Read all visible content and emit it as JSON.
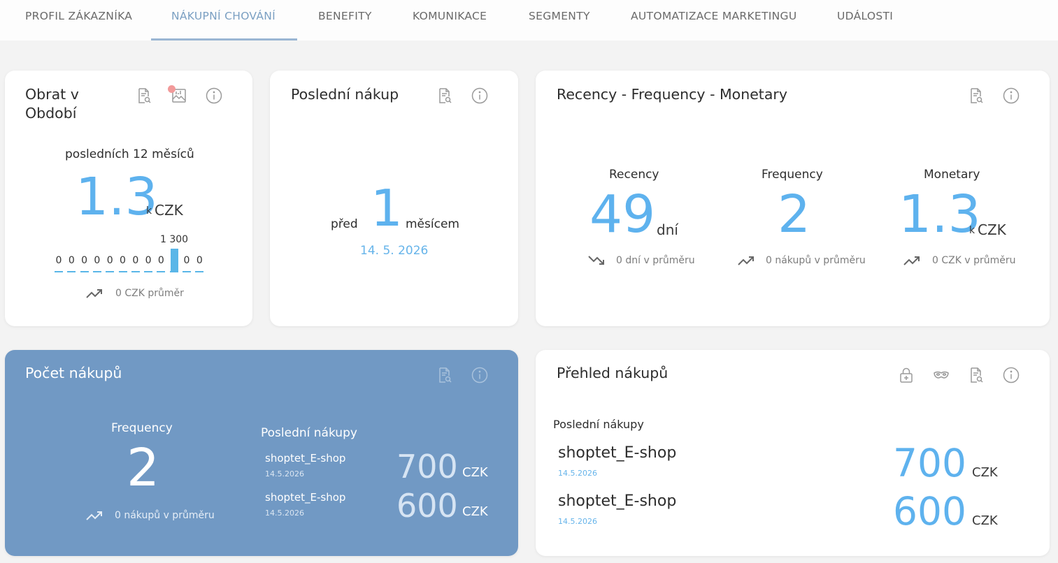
{
  "tabs": [
    {
      "label": "PROFIL ZÁKAZNÍKA",
      "active": false
    },
    {
      "label": "NÁKUPNÍ CHOVÁNÍ",
      "active": true
    },
    {
      "label": "BENEFITY",
      "active": false
    },
    {
      "label": "KOMUNIKACE",
      "active": false
    },
    {
      "label": "SEGMENTY",
      "active": false
    },
    {
      "label": "AUTOMATIZACE MARKETINGU",
      "active": false
    },
    {
      "label": "UDÁLOSTI",
      "active": false
    }
  ],
  "turnover": {
    "title_line1": "Obrat v",
    "title_line2": "Období",
    "period": "posledních 12 měsíců",
    "value": "1.3",
    "suffix": "k",
    "currency": "CZK",
    "bar_label": "1 300",
    "bars": [
      "0",
      "0",
      "0",
      "0",
      "0",
      "0",
      "0",
      "0",
      "0",
      "",
      "0",
      "0"
    ],
    "bar_values": [
      0,
      0,
      0,
      0,
      0,
      0,
      0,
      0,
      0,
      1300,
      0,
      0
    ],
    "avg": "0 CZK průměr"
  },
  "last_purchase": {
    "title": "Poslední nákup",
    "prefix": "před",
    "value": "1",
    "suffix": "měsícem",
    "date": "14. 5. 2026"
  },
  "rfm": {
    "title": "Recency - Frequency - Monetary",
    "recency": {
      "label": "Recency",
      "value": "49",
      "unit": "dní",
      "avg": "0 dní v průměru"
    },
    "frequency": {
      "label": "Frequency",
      "value": "2",
      "avg": "0 nákupů v průměru"
    },
    "monetary": {
      "label": "Monetary",
      "value": "1.3",
      "suffix": "k",
      "unit": "CZK",
      "avg": "0 CZK v průměru"
    }
  },
  "purchase_count": {
    "title": "Počet nákupů",
    "freq_label": "Frequency",
    "freq_value": "2",
    "freq_avg": "0 nákupů v průměru",
    "recent_label": "Poslední nákupy",
    "items": [
      {
        "shop": "shoptet_E-shop",
        "date": "14.5.2026",
        "amount": "700",
        "currency": "CZK"
      },
      {
        "shop": "shoptet_E-shop",
        "date": "14.5.2026",
        "amount": "600",
        "currency": "CZK"
      }
    ]
  },
  "purchase_overview": {
    "title": "Přehled nákupů",
    "recent_label": "Poslední nákupy",
    "items": [
      {
        "shop": "shoptet_E-shop",
        "date": "14.5.2026",
        "amount": "700",
        "currency": "CZK"
      },
      {
        "shop": "shoptet_E-shop",
        "date": "14.5.2026",
        "amount": "600",
        "currency": "CZK"
      }
    ]
  },
  "colors": {
    "accent": "#5eb2ee",
    "tab_active": "#7a9fc2",
    "blue_card": "#7199c4",
    "badge": "#f29a9a"
  },
  "icons": [
    "report-search-icon",
    "chart-image-icon",
    "info-icon",
    "lock-plus-icon",
    "mask-icon",
    "trend-up-icon",
    "trend-down-icon"
  ]
}
